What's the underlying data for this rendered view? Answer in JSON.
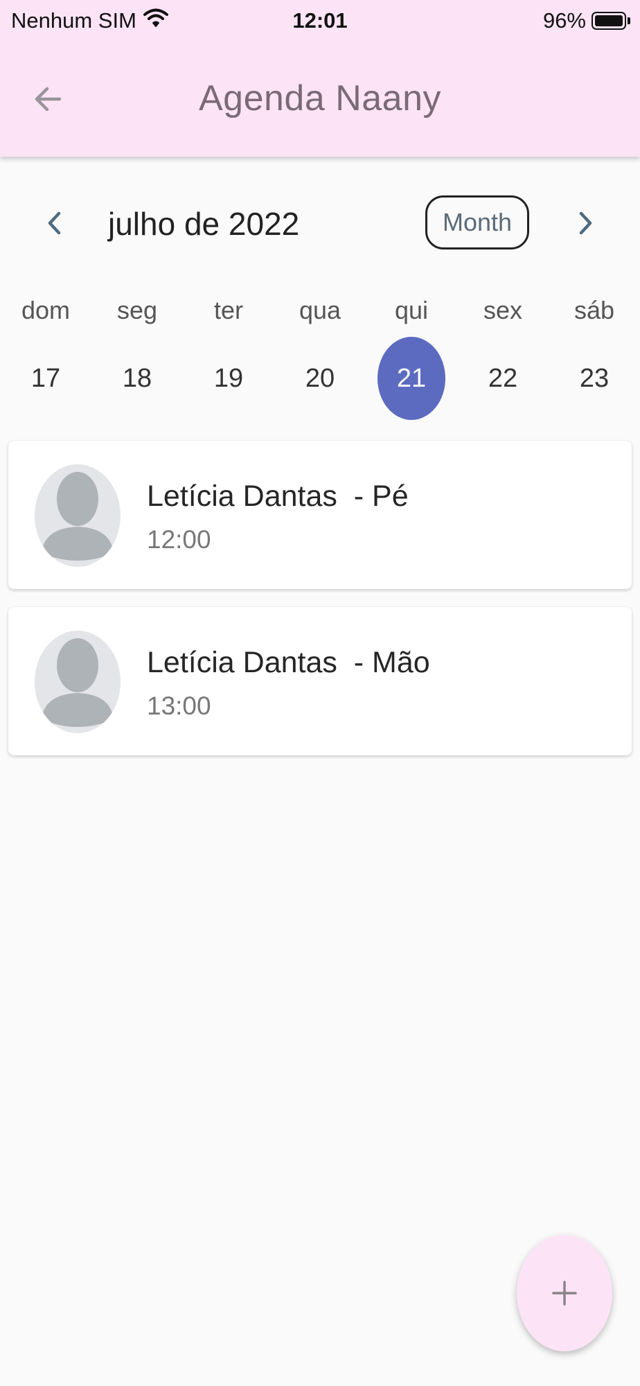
{
  "status_bar": {
    "carrier": "Nenhum SIM",
    "time": "12:01",
    "battery": "96%"
  },
  "app_bar": {
    "title": "Agenda Naany",
    "background": "#fce4f6",
    "back_icon": "arrow-left-icon"
  },
  "calendar": {
    "month_label": "julho de 2022",
    "format_button": "Month",
    "prev_icon": "chevron-left-icon",
    "next_icon": "chevron-right-icon",
    "selected_color": "#5c6bc0",
    "weekdays": [
      "dom",
      "seg",
      "ter",
      "qua",
      "qui",
      "sex",
      "sáb"
    ],
    "days": [
      "17",
      "18",
      "19",
      "20",
      "21",
      "22",
      "23"
    ],
    "selected_day": "21"
  },
  "events": [
    {
      "name": "Letícia Dantas  - Pé",
      "time": "12:00",
      "avatar_icon": "person-placeholder-icon"
    },
    {
      "name": "Letícia Dantas  - Mão",
      "time": "13:00",
      "avatar_icon": "person-placeholder-icon"
    }
  ],
  "fab": {
    "icon": "plus-icon",
    "background": "#fce4f6"
  }
}
